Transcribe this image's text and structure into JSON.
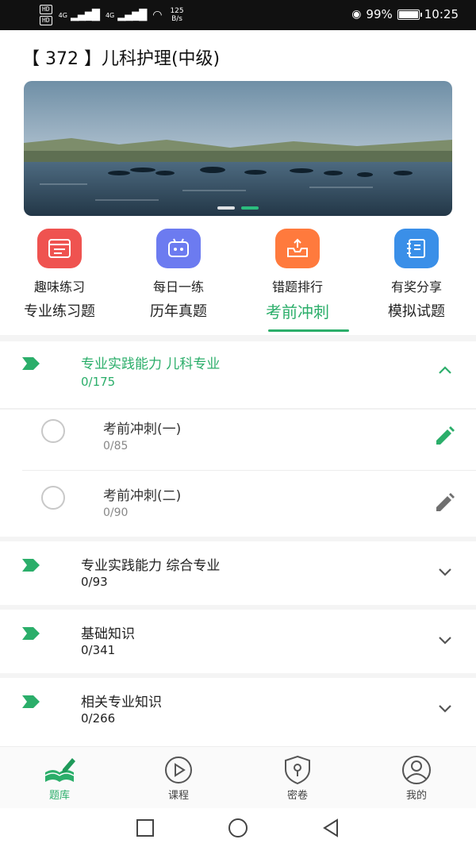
{
  "status_bar": {
    "hd_1": "HD",
    "hd_2": "HD",
    "network_1": "4G",
    "network_2": "4G",
    "speed_value": "125",
    "speed_unit": "B/s",
    "battery_level": 0.99,
    "battery_text": "99%",
    "time": "10:25"
  },
  "header": {
    "title": "【 372 】儿科护理(中级)"
  },
  "banner": {
    "slide_count": 2,
    "active_slide": 2
  },
  "quick_actions": [
    {
      "label": "趣味练习",
      "icon": "browser-list-icon",
      "color": "#ef5350"
    },
    {
      "label": "每日一练",
      "icon": "robot-face-icon",
      "color": "#6c7bf0"
    },
    {
      "label": "错题排行",
      "icon": "inbox-upload-icon",
      "color": "#ff7a3d"
    },
    {
      "label": "有奖分享",
      "icon": "notebook-icon",
      "color": "#3a8fe8"
    }
  ],
  "tabs": [
    "专业练习题",
    "历年真题",
    "考前冲刺",
    "模拟试题"
  ],
  "active_tab": 2,
  "chapters": [
    {
      "title": "专业实践能力 儿科专业",
      "count": "0/175",
      "expanded": true,
      "items": [
        {
          "title": "考前冲刺(一)",
          "count": "0/85"
        },
        {
          "title": "考前冲刺(二)",
          "count": "0/90"
        }
      ]
    },
    {
      "title": "专业实践能力 综合专业",
      "count": "0/93",
      "expanded": false
    },
    {
      "title": "基础知识",
      "count": "0/341",
      "expanded": false
    },
    {
      "title": "相关专业知识",
      "count": "0/266",
      "expanded": false
    }
  ],
  "bottom_nav": [
    {
      "label": "题库",
      "icon": "book-pencil-icon"
    },
    {
      "label": "课程",
      "icon": "play-circle-icon"
    },
    {
      "label": "密卷",
      "icon": "shield-lock-icon"
    },
    {
      "label": "我的",
      "icon": "user-circle-icon"
    }
  ],
  "active_nav": 0,
  "colors": {
    "accent": "#2bae6a",
    "accent_dark": "#1f9a5a"
  }
}
